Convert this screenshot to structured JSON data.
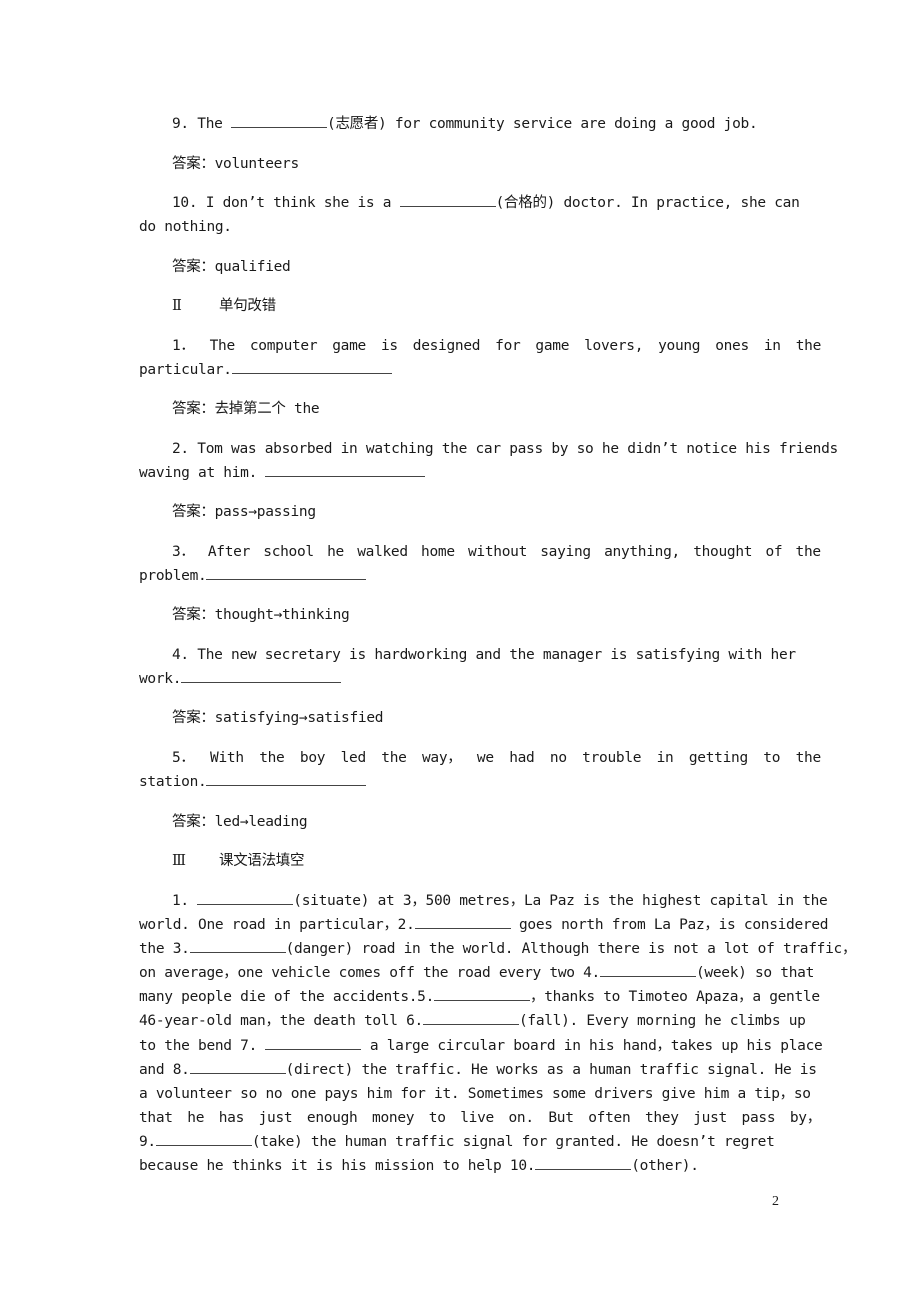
{
  "section1_tail": {
    "q9": {
      "num": "9. The ",
      "hint": "(志愿者) for community service are doing a good job.",
      "answer_label": "答案：",
      "answer": "volunteers"
    },
    "q10": {
      "num": "10. I don’t think she is a ",
      "hint": "(合格的) doctor. In practice, she can",
      "line2": "do nothing.",
      "answer_label": "答案：",
      "answer": "qualified"
    }
  },
  "section2": {
    "numeral": "Ⅱ",
    "title": "单句改错",
    "items": [
      {
        "line1": [
          "1．",
          "The",
          "computer",
          "game",
          "is",
          "designed",
          "for",
          "game",
          "lovers,",
          "young",
          "ones",
          "in",
          "the"
        ],
        "line2": "particular.",
        "answer_label": "答案：",
        "answer": "去掉第二个 the"
      },
      {
        "line1": "2. Tom was absorbed in watching the car pass by so he didn’t notice his friends",
        "line2": "waving at him. ",
        "answer_label": "答案：",
        "answer": "pass→passing"
      },
      {
        "line1": [
          "3．",
          "After",
          "school",
          "he",
          "walked",
          "home",
          "without",
          "saying",
          "anything,",
          "thought",
          "of",
          "the"
        ],
        "line2": "problem.",
        "answer_label": "答案：",
        "answer": "thought→thinking"
      },
      {
        "line1": "4. The new secretary is hardworking and the manager is satisfying with her",
        "line2": "work.",
        "answer_label": "答案：",
        "answer": "satisfying→satisfied"
      },
      {
        "line1": [
          "5．",
          "With",
          "the",
          "boy",
          "led",
          "the",
          "way，",
          "we",
          "had",
          "no",
          "trouble",
          "in",
          "getting",
          "to",
          "the"
        ],
        "line2": "station.",
        "answer_label": "答案：",
        "answer": "led→leading"
      }
    ]
  },
  "section3": {
    "numeral": "Ⅲ",
    "title": "课文语法填空",
    "lines": [
      {
        "pre": "1. ",
        "post": "(situate) at 3，500 metres，La Paz is the highest capital in the"
      },
      {
        "pre": "world. One road in particular，2.",
        "post": " goes north from La Paz，is considered"
      },
      {
        "pre": "the 3.",
        "post": "(danger) road in the world. Although there is not a lot of traffic，"
      },
      {
        "pre": "on average，one vehicle comes off the road every two 4.",
        "post": "(week) so that"
      },
      {
        "pre": "many people die of the accidents.5.",
        "post": "，thanks to Timoteo Apaza，a gentle"
      },
      {
        "pre": "46-year-old man，the death toll 6.",
        "post": "(fall). Every morning he climbs up"
      },
      {
        "pre": "to the bend 7. ",
        "post": " a large circular board in his hand，takes up his place"
      },
      {
        "pre": "and 8.",
        "post": "(direct) the traffic. He works as a human traffic signal. He is"
      },
      {
        "pre": "a volunteer so no one pays him for it. Sometimes some drivers give him a tip，so",
        "post": ""
      },
      {
        "pre": "that he has just enough money to live on. But often they just pass by，",
        "post": ""
      },
      {
        "pre": "9.",
        "post": "(take) the human traffic signal for granted. He doesn’t regret"
      },
      {
        "pre": "because he thinks it is his mission to help 10.",
        "post": "(other)."
      }
    ]
  },
  "page_number": "2"
}
